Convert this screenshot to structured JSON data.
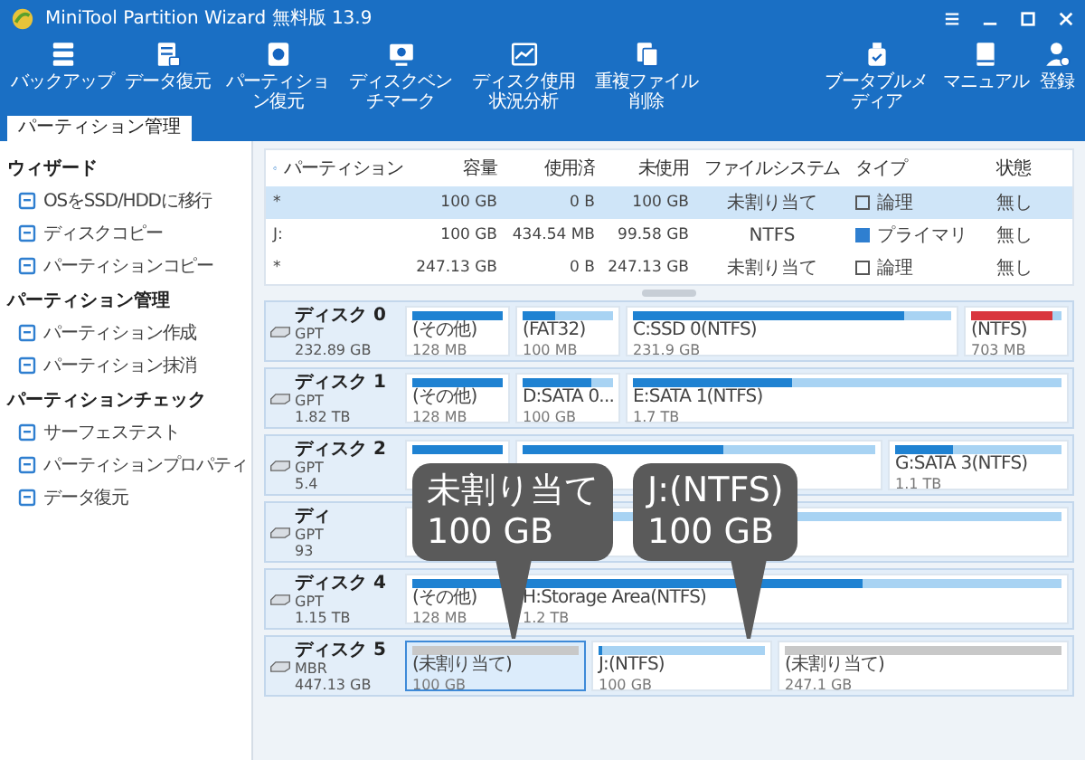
{
  "window": {
    "title": "MiniTool Partition Wizard 無料版 13.9"
  },
  "toolbar": {
    "left": [
      "バックアップ",
      "データ復元",
      "パーティション復元",
      "ディスクベンチマーク",
      "ディスク使用状況分析",
      "重複ファイル削除"
    ],
    "right": [
      "ブータブルメディア",
      "マニュアル",
      "登録"
    ]
  },
  "tabs": [
    {
      "label": "パーティション管理",
      "selected": true
    }
  ],
  "sidebar": [
    {
      "title": "ウィザード",
      "items": [
        "OSをSSD/HDDに移行",
        "ディスクコピー",
        "パーティションコピー"
      ]
    },
    {
      "title": "パーティション管理",
      "items": [
        "パーティション作成",
        "パーティション抹消"
      ]
    },
    {
      "title": "パーティションチェック",
      "items": [
        "サーフェステスト",
        "パーティションプロパティ",
        "データ復元"
      ]
    }
  ],
  "table": {
    "columns": [
      "パーティション",
      "容量",
      "使用済",
      "未使用",
      "ファイルシステム",
      "タイプ",
      "状態"
    ],
    "rows": [
      {
        "partition": "*",
        "capacity": "100 GB",
        "used": "0 B",
        "unused": "100 GB",
        "filesystem": "未割り当て",
        "kind": "logical",
        "type": "論理",
        "status": "無し",
        "selected": true
      },
      {
        "partition": "J:",
        "capacity": "100 GB",
        "used": "434.54 MB",
        "unused": "99.58 GB",
        "filesystem": "NTFS",
        "kind": "primary",
        "type": "プライマリ",
        "status": "無し",
        "selected": false
      },
      {
        "partition": "*",
        "capacity": "247.13 GB",
        "used": "0 B",
        "unused": "247.13 GB",
        "filesystem": "未割り当て",
        "kind": "logical",
        "type": "論理",
        "status": "無し",
        "selected": false
      }
    ]
  },
  "disks": [
    {
      "name": "ディスク 0",
      "style": "GPT",
      "size": "232.89 GB",
      "partitions": [
        {
          "kind": "small",
          "label": "(その他)",
          "size": "128 MB",
          "level": 1,
          "color": "#1f82d2",
          "unallocated": false,
          "selected": false
        },
        {
          "kind": "small",
          "label": "(FAT32)",
          "size": "100 MB",
          "level": 0.35,
          "color": "#1f82d2",
          "unallocated": false,
          "selected": false
        },
        {
          "kind": "wide",
          "label": "C:SSD 0(NTFS)",
          "size": "231.9 GB",
          "level": 0.85,
          "color": "#1f82d2",
          "unallocated": false,
          "selected": false
        },
        {
          "kind": "small",
          "label": "(NTFS)",
          "size": "703 MB",
          "level": 0.9,
          "color": "#d9363e",
          "unallocated": false,
          "selected": false
        }
      ]
    },
    {
      "name": "ディスク 1",
      "style": "GPT",
      "size": "1.82 TB",
      "partitions": [
        {
          "kind": "small",
          "label": "(その他)",
          "size": "128 MB",
          "level": 1,
          "color": "#1f82d2",
          "unallocated": false,
          "selected": false
        },
        {
          "kind": "small",
          "label": "D:SATA 0...",
          "size": "100 GB",
          "level": 0.75,
          "color": "#1f82d2",
          "unallocated": false,
          "selected": false
        },
        {
          "kind": "wide",
          "label": "E:SATA 1(NTFS)",
          "size": "1.7 TB",
          "level": 0.37,
          "color": "#1f82d2",
          "unallocated": false,
          "selected": false
        }
      ]
    },
    {
      "name": "ディスク 2",
      "style": "GPT",
      "size": "5.4",
      "partitions": [
        {
          "kind": "small",
          "level": 1,
          "color": "#1f82d2",
          "unallocated": false,
          "selected": false
        },
        {
          "kind": "wide",
          "level": 0.57,
          "color": "#1f82d2",
          "unallocated": false,
          "selected": false
        },
        {
          "kind": "medium",
          "label": "G:SATA 3(NTFS)",
          "size": "1.1 TB",
          "level": 0.35,
          "color": "#1f82d2",
          "unallocated": false,
          "selected": false
        }
      ]
    },
    {
      "name": "ディ",
      "style": "GPT",
      "size": "93",
      "partitions": [
        {
          "kind": "wide",
          "unallocated": false,
          "selected": false
        }
      ]
    },
    {
      "name": "ディスク 4",
      "style": "GPT",
      "size": "1.15 TB",
      "partitions": [
        {
          "kind": "small",
          "label": "(その他)",
          "size": "128 MB",
          "level": 1,
          "color": "#1f82d2",
          "unallocated": false,
          "selected": false
        },
        {
          "kind": "wide",
          "label": "H:Storage Area(NTFS)",
          "size": "1.2 TB",
          "level": 0.63,
          "color": "#1f82d2",
          "unallocated": false,
          "selected": false
        }
      ]
    },
    {
      "name": "ディスク 5",
      "style": "MBR",
      "size": "447.13 GB",
      "partitions": [
        {
          "kind": "medium",
          "label": "(未割り当て)",
          "size": "100 GB",
          "unallocated": true,
          "selected": true
        },
        {
          "kind": "medium",
          "label": "J:(NTFS)",
          "size": "100 GB",
          "level": 0.02,
          "color": "#1f82d2",
          "unallocated": false,
          "selected": false
        },
        {
          "kind": "wide",
          "label": "(未割り当て)",
          "size": "247.1 GB",
          "unallocated": true,
          "selected": false
        }
      ]
    }
  ],
  "callouts": [
    {
      "title": "未割り当て",
      "value": "100 GB"
    },
    {
      "title": "J:(NTFS)",
      "value": "100 GB"
    }
  ]
}
